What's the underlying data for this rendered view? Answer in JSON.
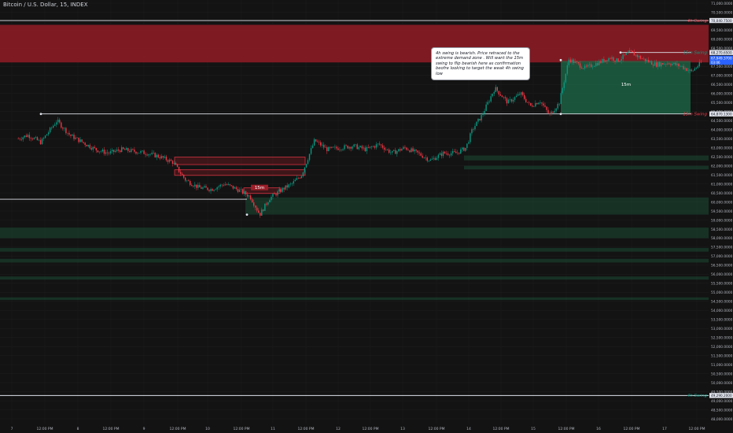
{
  "header": {
    "symbol_title": "Bitcoin / U.S. Dollar, 15, INDEX"
  },
  "annotation": {
    "text": "4h swing is bearish. Price retraced to the extreme demand zone . Will want the 15m swing to flip bearish here as confirmation beofre looking to target the weak 4h swing low"
  },
  "colors": {
    "background": "#131313",
    "grid": "#1c1c1c",
    "up_candle": "#089981",
    "down_candle": "#f23645",
    "supply_zone": "#8b1c25",
    "demand_zone": "#1c4a35",
    "swing_line": "#e0e3eb",
    "current_price_bg": "#2962ff"
  },
  "chart_data": {
    "type": "candlestick",
    "title": "Bitcoin / U.S. Dollar, 15, INDEX",
    "ylim": [
      48000,
      71000
    ],
    "x_ticks": [
      "7",
      "12:00 PM",
      "8",
      "12:00 PM",
      "9",
      "12:00 PM",
      "10",
      "12:00 PM",
      "11",
      "12:00 PM",
      "12",
      "12:00 PM",
      "13",
      "12:00 PM",
      "14",
      "12:00 PM",
      "15",
      "12:00 PM",
      "16",
      "12:00 PM",
      "17",
      "12:00 PM"
    ],
    "y_ticks": [
      "71,000.0000",
      "70,500.0000",
      "70,000.0000",
      "69,500.0000",
      "69,000.0000",
      "68,500.0000",
      "68,000.0000",
      "67,500.0000",
      "67,000.0000",
      "66,500.0000",
      "66,000.0000",
      "65,500.0000",
      "65,000.0000",
      "64,500.0000",
      "64,000.0000",
      "63,500.0000",
      "63,000.0000",
      "62,500.0000",
      "62,000.0000",
      "61,500.0000",
      "61,000.0000",
      "60,500.0000",
      "60,000.0000",
      "59,500.0000",
      "59,000.0000",
      "58,500.0000",
      "58,000.0000",
      "57,500.0000",
      "57,000.0000",
      "56,500.0000",
      "56,000.0000",
      "55,500.0000",
      "55,000.0000",
      "54,500.0000",
      "54,000.0000",
      "53,500.0000",
      "53,000.0000",
      "52,500.0000",
      "52,000.0000",
      "51,500.0000",
      "51,000.0000",
      "50,500.0000",
      "50,000.0000",
      "49,500.0000",
      "49,000.0000",
      "48,500.0000",
      "48,000.0000"
    ],
    "levels": [
      {
        "name": "4h Swing",
        "price": 70040,
        "price_label": "70,040.7500",
        "color": "#e0e3eb",
        "label_color": "#f23645"
      },
      {
        "name": "15m Swing",
        "price": 68270,
        "price_label": "68,270.6500",
        "color": "#e0e3eb",
        "label_color": "#089981"
      },
      {
        "name": "15m Swing",
        "price": 64870,
        "price_label": "64,870.1300",
        "color": "#e0e3eb",
        "label_color": "#f23645"
      },
      {
        "name": "4h Swing",
        "price": 49290,
        "price_label": "49,290.2000",
        "color": "#e0e3eb",
        "label_color": "#089981"
      }
    ],
    "current_price": {
      "price": 67949,
      "label": "67,949.3700",
      "sub_label": "03:06"
    },
    "supply_zones": [
      {
        "from": 67720,
        "to": 69800
      },
      {
        "from": 62070,
        "to": 62480
      },
      {
        "from": 61470,
        "to": 61780
      },
      {
        "from": 60470,
        "to": 60780
      }
    ],
    "demand_zones": [
      {
        "from": 62300,
        "to": 62570
      },
      {
        "from": 61800,
        "to": 62000
      },
      {
        "from": 59300,
        "to": 60250
      },
      {
        "from": 58000,
        "to": 58580
      },
      {
        "from": 57250,
        "to": 57450
      },
      {
        "from": 56650,
        "to": 56850
      },
      {
        "from": 55700,
        "to": 55880
      },
      {
        "from": 54580,
        "to": 54720
      }
    ],
    "zone_labels": [
      {
        "text": "15m",
        "x_day": 8.2,
        "price": 60800
      },
      {
        "text": "15m",
        "x_day": 13.85,
        "price": 66500
      }
    ],
    "price_path": [
      [
        6.0,
        63500
      ],
      [
        6.15,
        63700
      ],
      [
        6.35,
        63300
      ],
      [
        6.6,
        64500
      ],
      [
        6.8,
        63700
      ],
      [
        7.0,
        63300
      ],
      [
        7.2,
        62900
      ],
      [
        7.4,
        62700
      ],
      [
        7.6,
        62900
      ],
      [
        7.8,
        62800
      ],
      [
        8.0,
        62700
      ],
      [
        8.2,
        62500
      ],
      [
        8.4,
        62200
      ],
      [
        8.6,
        61200
      ],
      [
        8.8,
        60800
      ],
      [
        9.0,
        60700
      ],
      [
        9.2,
        61000
      ],
      [
        9.4,
        60700
      ],
      [
        9.6,
        60300
      ],
      [
        9.75,
        59300
      ],
      [
        9.9,
        60200
      ],
      [
        10.1,
        60700
      ],
      [
        10.25,
        61000
      ],
      [
        10.4,
        61500
      ],
      [
        10.6,
        63400
      ],
      [
        10.8,
        62900
      ],
      [
        11.0,
        63000
      ],
      [
        11.2,
        63100
      ],
      [
        11.4,
        62900
      ],
      [
        11.6,
        63200
      ],
      [
        11.8,
        62700
      ],
      [
        12.0,
        63000
      ],
      [
        12.2,
        62700
      ],
      [
        12.4,
        62300
      ],
      [
        12.6,
        62700
      ],
      [
        12.8,
        62700
      ],
      [
        12.95,
        63000
      ],
      [
        13.05,
        64000
      ],
      [
        13.2,
        64800
      ],
      [
        13.4,
        66300
      ],
      [
        13.6,
        65500
      ],
      [
        13.8,
        66000
      ],
      [
        13.95,
        65300
      ],
      [
        14.1,
        65600
      ],
      [
        14.25,
        64800
      ],
      [
        14.4,
        65500
      ],
      [
        14.55,
        67900
      ],
      [
        14.8,
        67400
      ],
      [
        15.0,
        67700
      ],
      [
        15.2,
        68000
      ],
      [
        15.3,
        67800
      ],
      [
        15.5,
        68300
      ],
      [
        15.7,
        67900
      ],
      [
        15.9,
        67600
      ],
      [
        16.1,
        67700
      ],
      [
        16.3,
        67500
      ],
      [
        16.45,
        67200
      ],
      [
        16.6,
        67700
      ]
    ]
  }
}
